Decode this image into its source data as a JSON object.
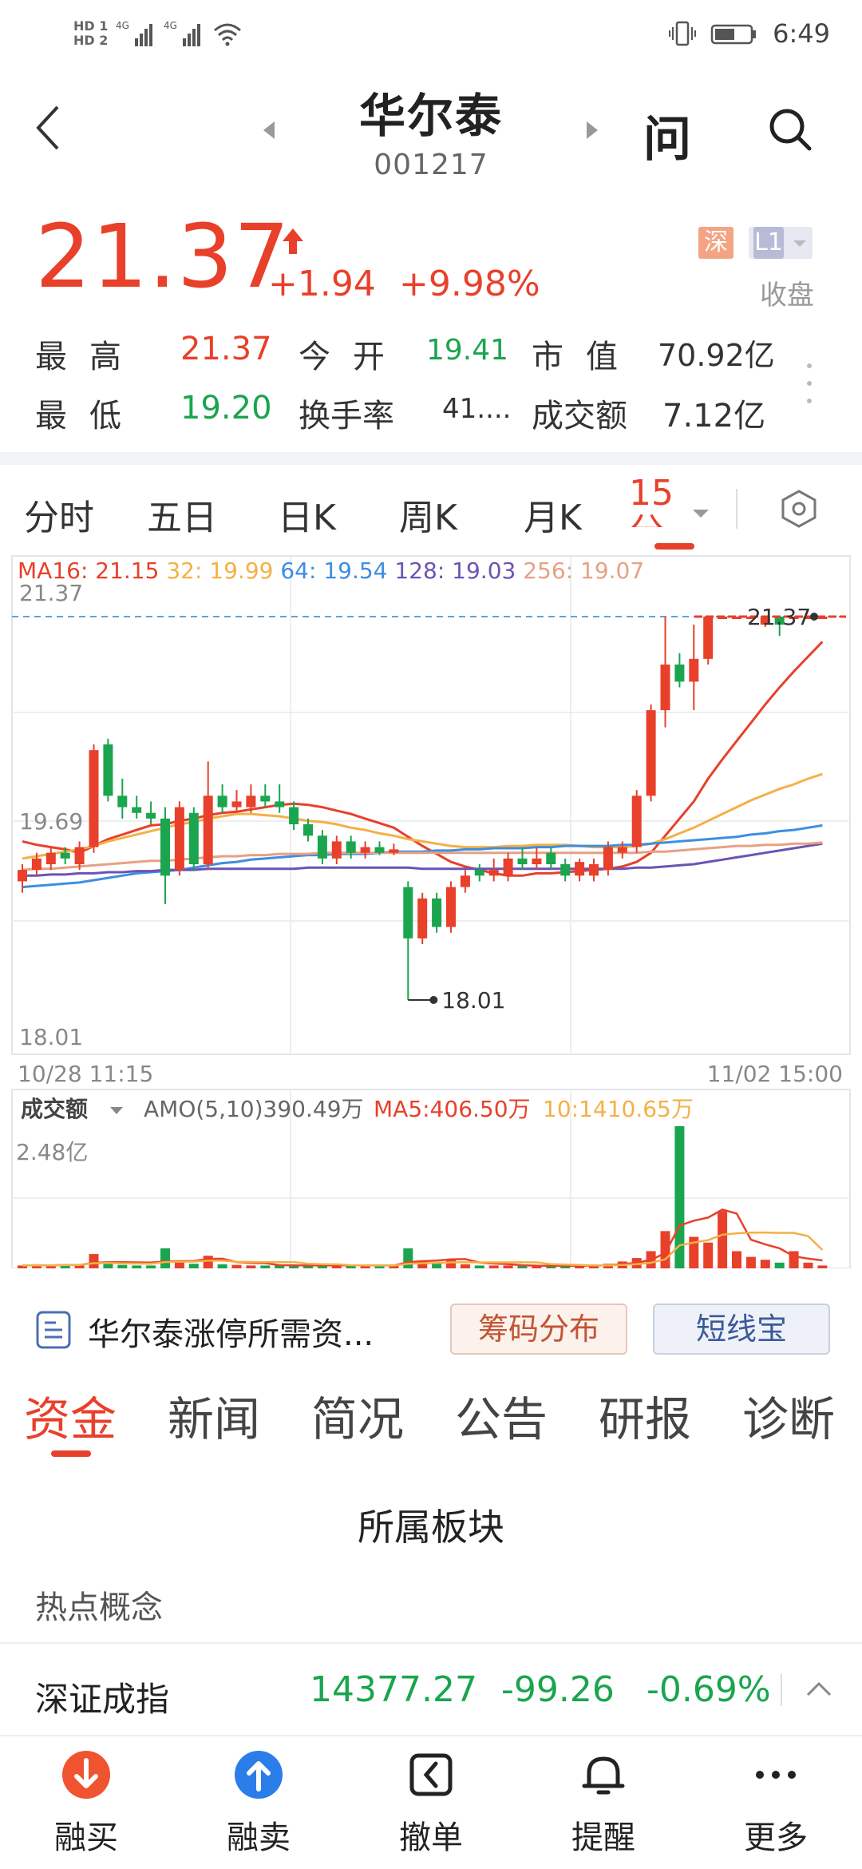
{
  "status_bar": {
    "time": "6:49",
    "sim1": "HD 1",
    "sim2": "HD 2",
    "network1": "4G",
    "network2": "4G"
  },
  "header": {
    "stock_name": "华尔泰",
    "stock_code": "001217",
    "ask_label": "问"
  },
  "quote": {
    "price": "21.37",
    "change": "+1.94",
    "change_pct": "+9.98%",
    "market_tag": "深",
    "level_tag": "L1",
    "status": "收盘",
    "rows": [
      [
        {
          "label": "最高",
          "value": "21.37",
          "color": "red"
        },
        {
          "label": "今开",
          "value": "19.41",
          "color": "green"
        },
        {
          "label": "市值",
          "value": "70.92亿",
          "color": "dark"
        }
      ],
      [
        {
          "label": "最低",
          "value": "19.20",
          "color": "green"
        },
        {
          "label": "换手率",
          "value": "41....",
          "color": "dark"
        },
        {
          "label": "成交额",
          "value": "7.12亿",
          "color": "dark"
        }
      ]
    ]
  },
  "period_tabs": {
    "items": [
      "分时",
      "五日",
      "日K",
      "周K",
      "月K"
    ],
    "active": "15分",
    "active_line1": "15",
    "active_line2": "分"
  },
  "chart_data": {
    "type": "candlestick",
    "interval": "15分",
    "ma_legend": [
      {
        "label": "MA16:",
        "value": "21.15",
        "color": "#e8402a"
      },
      {
        "label": "32:",
        "value": "19.99",
        "color": "#f4b047"
      },
      {
        "label": "64:",
        "value": "19.54",
        "color": "#3e8ee0"
      },
      {
        "label": "128:",
        "value": "19.03",
        "color": "#6a54b4"
      },
      {
        "label": "256:",
        "value": "19.07",
        "color": "#e8a083"
      }
    ],
    "y_axis_labels": [
      "21.37",
      "19.69",
      "18.01"
    ],
    "ylim": [
      18.01,
      21.37
    ],
    "x_axis_labels": [
      "10/28 11:15",
      "11/02 15:00"
    ],
    "high_marker": "21.37",
    "low_marker": "18.01",
    "candles": [
      {
        "o": 19.05,
        "c": 19.15,
        "h": 19.2,
        "l": 18.95
      },
      {
        "o": 19.15,
        "c": 19.25,
        "h": 19.3,
        "l": 19.1
      },
      {
        "o": 19.2,
        "c": 19.3,
        "h": 19.35,
        "l": 19.15
      },
      {
        "o": 19.3,
        "c": 19.25,
        "h": 19.35,
        "l": 19.2
      },
      {
        "o": 19.2,
        "c": 19.35,
        "h": 19.4,
        "l": 19.15
      },
      {
        "o": 19.35,
        "c": 20.2,
        "h": 20.25,
        "l": 19.3
      },
      {
        "o": 20.25,
        "c": 19.8,
        "h": 20.3,
        "l": 19.75
      },
      {
        "o": 19.8,
        "c": 19.7,
        "h": 19.95,
        "l": 19.6
      },
      {
        "o": 19.7,
        "c": 19.65,
        "h": 19.8,
        "l": 19.6
      },
      {
        "o": 19.65,
        "c": 19.6,
        "h": 19.75,
        "l": 19.55
      },
      {
        "o": 19.6,
        "c": 19.1,
        "h": 19.7,
        "l": 18.85
      },
      {
        "o": 19.15,
        "c": 19.7,
        "h": 19.75,
        "l": 19.1
      },
      {
        "o": 19.65,
        "c": 19.2,
        "h": 19.7,
        "l": 19.15
      },
      {
        "o": 19.2,
        "c": 19.8,
        "h": 20.1,
        "l": 19.15
      },
      {
        "o": 19.8,
        "c": 19.7,
        "h": 19.9,
        "l": 19.65
      },
      {
        "o": 19.7,
        "c": 19.75,
        "h": 19.85,
        "l": 19.65
      },
      {
        "o": 19.7,
        "c": 19.8,
        "h": 19.9,
        "l": 19.65
      },
      {
        "o": 19.8,
        "c": 19.75,
        "h": 19.9,
        "l": 19.7
      },
      {
        "o": 19.75,
        "c": 19.7,
        "h": 19.9,
        "l": 19.65
      },
      {
        "o": 19.7,
        "c": 19.55,
        "h": 19.75,
        "l": 19.5
      },
      {
        "o": 19.55,
        "c": 19.45,
        "h": 19.6,
        "l": 19.4
      },
      {
        "o": 19.45,
        "c": 19.25,
        "h": 19.5,
        "l": 19.2
      },
      {
        "o": 19.25,
        "c": 19.4,
        "h": 19.45,
        "l": 19.2
      },
      {
        "o": 19.4,
        "c": 19.3,
        "h": 19.45,
        "l": 19.25
      },
      {
        "o": 19.3,
        "c": 19.35,
        "h": 19.4,
        "l": 19.25
      },
      {
        "o": 19.35,
        "c": 19.3,
        "h": 19.4,
        "l": 19.28
      },
      {
        "o": 19.3,
        "c": 19.33,
        "h": 19.38,
        "l": 19.28
      },
      {
        "o": 19.0,
        "c": 18.55,
        "h": 19.05,
        "l": 18.01
      },
      {
        "o": 18.55,
        "c": 18.9,
        "h": 18.95,
        "l": 18.5
      },
      {
        "o": 18.9,
        "c": 18.65,
        "h": 18.95,
        "l": 18.6
      },
      {
        "o": 18.65,
        "c": 19.0,
        "h": 19.05,
        "l": 18.6
      },
      {
        "o": 19.0,
        "c": 19.1,
        "h": 19.15,
        "l": 18.95
      },
      {
        "o": 19.15,
        "c": 19.1,
        "h": 19.2,
        "l": 19.05
      },
      {
        "o": 19.1,
        "c": 19.15,
        "h": 19.25,
        "l": 19.05
      },
      {
        "o": 19.1,
        "c": 19.25,
        "h": 19.3,
        "l": 19.05
      },
      {
        "o": 19.25,
        "c": 19.2,
        "h": 19.35,
        "l": 19.15
      },
      {
        "o": 19.2,
        "c": 19.25,
        "h": 19.35,
        "l": 19.15
      },
      {
        "o": 19.3,
        "c": 19.2,
        "h": 19.35,
        "l": 19.15
      },
      {
        "o": 19.2,
        "c": 19.1,
        "h": 19.25,
        "l": 19.05
      },
      {
        "o": 19.1,
        "c": 19.22,
        "h": 19.25,
        "l": 19.05
      },
      {
        "o": 19.1,
        "c": 19.2,
        "h": 19.25,
        "l": 19.05
      },
      {
        "o": 19.15,
        "c": 19.35,
        "h": 19.4,
        "l": 19.1
      },
      {
        "o": 19.3,
        "c": 19.35,
        "h": 19.4,
        "l": 19.25
      },
      {
        "o": 19.35,
        "c": 19.8,
        "h": 19.85,
        "l": 19.3
      },
      {
        "o": 19.8,
        "c": 20.55,
        "h": 20.6,
        "l": 19.75
      },
      {
        "o": 20.55,
        "c": 20.95,
        "h": 21.37,
        "l": 20.4
      },
      {
        "o": 20.95,
        "c": 20.8,
        "h": 21.05,
        "l": 20.75
      },
      {
        "o": 20.8,
        "c": 21.0,
        "h": 21.3,
        "l": 20.55
      },
      {
        "o": 21.0,
        "c": 21.37,
        "h": 21.37,
        "l": 20.95
      },
      {
        "o": 21.37,
        "c": 21.37,
        "h": 21.37,
        "l": 21.37
      },
      {
        "o": 21.37,
        "c": 21.37,
        "h": 21.37,
        "l": 21.37
      },
      {
        "o": 21.37,
        "c": 21.37,
        "h": 21.37,
        "l": 21.37
      },
      {
        "o": 21.3,
        "c": 21.37,
        "h": 21.37,
        "l": 21.28
      },
      {
        "o": 21.37,
        "c": 21.3,
        "h": 21.37,
        "l": 21.2
      },
      {
        "o": 21.37,
        "c": 21.37,
        "h": 21.37,
        "l": 21.37
      },
      {
        "o": 21.37,
        "c": 21.37,
        "h": 21.37,
        "l": 21.37
      },
      {
        "o": 21.37,
        "c": 21.37,
        "h": 21.37,
        "l": 21.37
      }
    ],
    "ma_lines": {
      "ma16": [
        19.4,
        19.37,
        19.35,
        19.33,
        19.3,
        19.36,
        19.42,
        19.46,
        19.5,
        19.54,
        19.55,
        19.58,
        19.6,
        19.63,
        19.65,
        19.66,
        19.68,
        19.7,
        19.72,
        19.73,
        19.72,
        19.7,
        19.67,
        19.64,
        19.6,
        19.56,
        19.52,
        19.44,
        19.36,
        19.29,
        19.22,
        19.18,
        19.15,
        19.12,
        19.1,
        19.1,
        19.12,
        19.12,
        19.13,
        19.14,
        19.15,
        19.16,
        19.18,
        19.22,
        19.3,
        19.45,
        19.6,
        19.75,
        19.95,
        20.12,
        20.28,
        20.44,
        20.6,
        20.75,
        20.89,
        21.02,
        21.15
      ],
      "ma32": [
        19.25,
        19.27,
        19.29,
        19.31,
        19.33,
        19.36,
        19.4,
        19.43,
        19.46,
        19.49,
        19.52,
        19.55,
        19.57,
        19.6,
        19.62,
        19.64,
        19.64,
        19.63,
        19.62,
        19.6,
        19.58,
        19.57,
        19.55,
        19.52,
        19.5,
        19.47,
        19.45,
        19.42,
        19.4,
        19.38,
        19.36,
        19.35,
        19.35,
        19.35,
        19.36,
        19.36,
        19.37,
        19.37,
        19.37,
        19.36,
        19.35,
        19.35,
        19.35,
        19.36,
        19.38,
        19.42,
        19.47,
        19.52,
        19.58,
        19.64,
        19.7,
        19.76,
        19.81,
        19.86,
        19.9,
        19.95,
        19.99
      ],
      "ma64": [
        19.0,
        19.01,
        19.02,
        19.03,
        19.04,
        19.06,
        19.08,
        19.1,
        19.12,
        19.13,
        19.14,
        19.15,
        19.17,
        19.19,
        19.21,
        19.22,
        19.24,
        19.25,
        19.26,
        19.27,
        19.28,
        19.28,
        19.29,
        19.29,
        19.29,
        19.3,
        19.31,
        19.31,
        19.31,
        19.32,
        19.32,
        19.33,
        19.33,
        19.34,
        19.34,
        19.34,
        19.35,
        19.35,
        19.36,
        19.36,
        19.36,
        19.36,
        19.37,
        19.37,
        19.38,
        19.39,
        19.4,
        19.41,
        19.42,
        19.43,
        19.44,
        19.46,
        19.47,
        19.49,
        19.5,
        19.52,
        19.54
      ],
      "ma128": [
        19.1,
        19.1,
        19.11,
        19.11,
        19.12,
        19.12,
        19.13,
        19.13,
        19.14,
        19.14,
        19.15,
        19.15,
        19.15,
        19.16,
        19.16,
        19.16,
        19.16,
        19.16,
        19.16,
        19.16,
        19.17,
        19.17,
        19.17,
        19.17,
        19.17,
        19.17,
        19.17,
        19.17,
        19.16,
        19.16,
        19.16,
        19.16,
        19.16,
        19.16,
        19.16,
        19.16,
        19.16,
        19.16,
        19.16,
        19.16,
        19.16,
        19.16,
        19.16,
        19.17,
        19.17,
        19.18,
        19.19,
        19.2,
        19.22,
        19.24,
        19.26,
        19.28,
        19.3,
        19.32,
        19.34,
        19.36,
        19.03
      ],
      "ma256": [
        19.15,
        19.16,
        19.16,
        19.17,
        19.18,
        19.19,
        19.2,
        19.21,
        19.22,
        19.23,
        19.23,
        19.24,
        19.25,
        19.26,
        19.27,
        19.27,
        19.28,
        19.28,
        19.29,
        19.29,
        19.29,
        19.3,
        19.3,
        19.3,
        19.3,
        19.3,
        19.3,
        19.3,
        19.3,
        19.3,
        19.3,
        19.3,
        19.3,
        19.3,
        19.3,
        19.3,
        19.3,
        19.3,
        19.3,
        19.3,
        19.3,
        19.3,
        19.3,
        19.3,
        19.31,
        19.31,
        19.32,
        19.33,
        19.34,
        19.35,
        19.36,
        19.36,
        19.37,
        19.37,
        19.38,
        19.38,
        19.07
      ]
    },
    "volume_panel": {
      "selector": "成交额",
      "amo": "AMO(5,10)390.49万",
      "ma5": "MA5:406.50万",
      "ma10": "10:1410.65万",
      "y_max_label": "2.48亿",
      "y_max": 2.48,
      "volumes": [
        0.05,
        0.06,
        0.05,
        0.07,
        0.06,
        0.25,
        0.1,
        0.06,
        0.05,
        0.05,
        0.35,
        0.12,
        0.08,
        0.22,
        0.07,
        0.06,
        0.05,
        0.05,
        0.05,
        0.05,
        0.05,
        0.05,
        0.06,
        0.05,
        0.05,
        0.04,
        0.05,
        0.35,
        0.14,
        0.1,
        0.15,
        0.07,
        0.05,
        0.05,
        0.05,
        0.05,
        0.04,
        0.04,
        0.05,
        0.05,
        0.06,
        0.08,
        0.12,
        0.18,
        0.3,
        0.65,
        2.48,
        0.55,
        0.45,
        1.0,
        0.3,
        0.2,
        0.15,
        0.1,
        0.3,
        0.1,
        0.05
      ]
    }
  },
  "news": {
    "headline": "华尔泰涨停所需资...",
    "chip1": "筹码分布",
    "chip2": "短线宝"
  },
  "info_tabs": {
    "items": [
      "资金",
      "新闻",
      "简况",
      "公告",
      "研报",
      "诊断"
    ],
    "active": "资金"
  },
  "sector": {
    "title": "所属板块",
    "hot_label": "热点概念"
  },
  "index_bar": {
    "name": "深证成指",
    "value": "14377.27",
    "change": "-99.26",
    "change_pct": "-0.69%"
  },
  "bottom_nav": [
    {
      "label": "融买",
      "icon": "down-arrow-circle-icon"
    },
    {
      "label": "融卖",
      "icon": "up-arrow-circle-icon"
    },
    {
      "label": "撤单",
      "icon": "undo-box-icon"
    },
    {
      "label": "提醒",
      "icon": "bell-icon"
    },
    {
      "label": "更多",
      "icon": "more-dots-icon"
    }
  ],
  "colors": {
    "up": "#e8402a",
    "down": "#1aa54e",
    "accent": "#e8402a"
  }
}
